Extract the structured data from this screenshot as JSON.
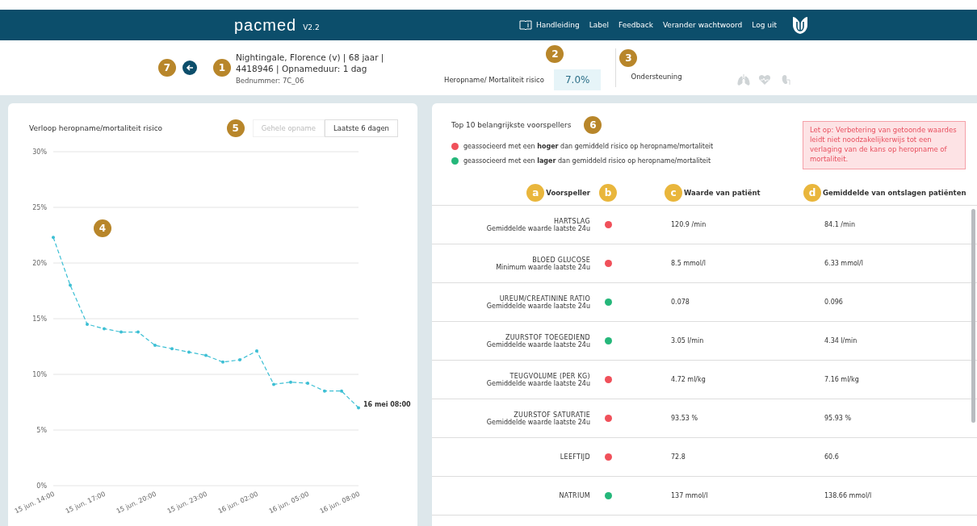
{
  "header": {
    "logo": "pacmed",
    "version": "V2.2",
    "nav": [
      {
        "label": "Handleiding",
        "kind": "manual"
      },
      {
        "label": "Label",
        "kind": "plain"
      },
      {
        "label": "Feedback",
        "kind": "plain"
      },
      {
        "label": "Verander wachtwoord",
        "kind": "plain"
      },
      {
        "label": "Log uit",
        "kind": "plain"
      }
    ]
  },
  "patient": {
    "badge_back": "7",
    "badge_info": "1",
    "name_line": "Nightingale, Florence (v) | 68 jaar | 4418946 | Opnameduur: 1 dag",
    "bed": "Bednummer: 7C_06",
    "risk_badge": "2",
    "risk_label": "Heropname/ Mortaliteit risico",
    "risk_value": "7.0%",
    "support_badge": "3",
    "support_label": "Ondersteuning",
    "support_icons": [
      {
        "kind": "lungs",
        "on": false
      },
      {
        "kind": "heart",
        "on": false
      },
      {
        "kind": "kidney",
        "on": false
      }
    ]
  },
  "chart_panel": {
    "title": "Verloop heropname/mortaliteit risico",
    "range_badge": "5",
    "chart_badge": "4",
    "ranges": [
      {
        "label": "Gehele opname",
        "selected": false
      },
      {
        "label": "Laatste 6 dagen",
        "selected": true
      }
    ],
    "chart_data": {
      "type": "line",
      "categories": [
        "15 jun. 14:00",
        null,
        null,
        "15 jun. 17:00",
        null,
        null,
        "15 jun. 20:00",
        null,
        null,
        "15 jun. 23:00",
        null,
        null,
        "16 jun. 02:00",
        null,
        null,
        "16 jun. 05:00",
        null,
        null,
        "16 jun. 08:00"
      ],
      "series": [
        {
          "color": "#3cbfd4",
          "line_style": "dashed",
          "values": [
            22.3,
            18.0,
            14.5,
            14.1,
            13.8,
            13.8,
            12.6,
            12.3,
            12.0,
            11.7,
            11.1,
            11.3,
            12.1,
            9.1,
            9.3,
            9.2,
            8.5,
            8.5,
            7.0
          ]
        }
      ],
      "ylim": [
        0,
        30
      ],
      "yticks": [
        {
          "value": 0,
          "label": "0%"
        },
        {
          "value": 5,
          "label": "5%"
        },
        {
          "value": 10,
          "label": "10%"
        },
        {
          "value": 15,
          "label": "15%"
        },
        {
          "value": 20,
          "label": "20%"
        },
        {
          "value": 25,
          "label": "25%"
        },
        {
          "value": 30,
          "label": "30%"
        }
      ],
      "grid": true,
      "annotations": [
        {
          "x": "16 jun. 08:00",
          "y": 7.0,
          "text": "16 mei 08:00"
        }
      ]
    }
  },
  "predictors_panel": {
    "title": "Top 10 belangrijkste voorspellers",
    "badge": "6",
    "legend": [
      {
        "text": "geassocieerd met een **hoger** dan gemiddeld risico op heropname/mortaliteit",
        "color": "#f0505a"
      },
      {
        "text": "geassocieerd met een **lager** dan gemiddeld risico op heropname/mortaliteit",
        "color": "#25b77a"
      }
    ],
    "warning": "Let op: Verbetering van getoonde waardes leidt niet noodzakelijkerwijs tot een verlaging van de kans op heropname of mortaliteit.",
    "columns": [
      {
        "badge": "a",
        "label": "Voorspeller"
      },
      {
        "badge": "b"
      },
      {
        "badge": "c",
        "label": "Waarde van patiënt"
      },
      {
        "badge": "d",
        "label": "Gemiddelde van ontslagen patiënten"
      }
    ],
    "rows": [
      {
        "name": "HARTSLAG",
        "detail": "Gemiddelde waarde laatste 24u",
        "color": "#f0505a",
        "value": "120.9 /min",
        "mean": "84.1 /min"
      },
      {
        "name": "BLOED GLUCOSE",
        "detail": "Minimum waarde laatste 24u",
        "color": "#f0505a",
        "value": "8.5 mmol/l",
        "mean": "6.33 mmol/l"
      },
      {
        "name": "UREUM/CREATININE RATIO",
        "detail": "Gemiddelde waarde laatste 24u",
        "color": "#25b77a",
        "value": "0.078",
        "mean": "0.096"
      },
      {
        "name": "ZUURSTOF TOEGEDIEND",
        "detail": "Gemiddelde waarde laatste 24u",
        "color": "#25b77a",
        "value": "3.05 l/min",
        "mean": "4.34 l/min"
      },
      {
        "name": "TEUGVOLUME (PER KG)",
        "detail": "Gemiddelde waarde laatste 24u",
        "color": "#f0505a",
        "value": "4.72 ml/kg",
        "mean": "7.16 ml/kg"
      },
      {
        "name": "ZUURSTOF SATURATIE",
        "detail": "Gemiddelde waarde laatste 24u",
        "color": "#f0505a",
        "value": "93.53 %",
        "mean": "95.93 %"
      },
      {
        "name": "LEEFTIJD",
        "color": "#f0505a",
        "value": "72.8",
        "mean": "60.6"
      },
      {
        "name": "NATRIUM",
        "color": "#25b77a",
        "value": "137 mmol/l",
        "mean": "138.66 mmol/l"
      }
    ]
  }
}
